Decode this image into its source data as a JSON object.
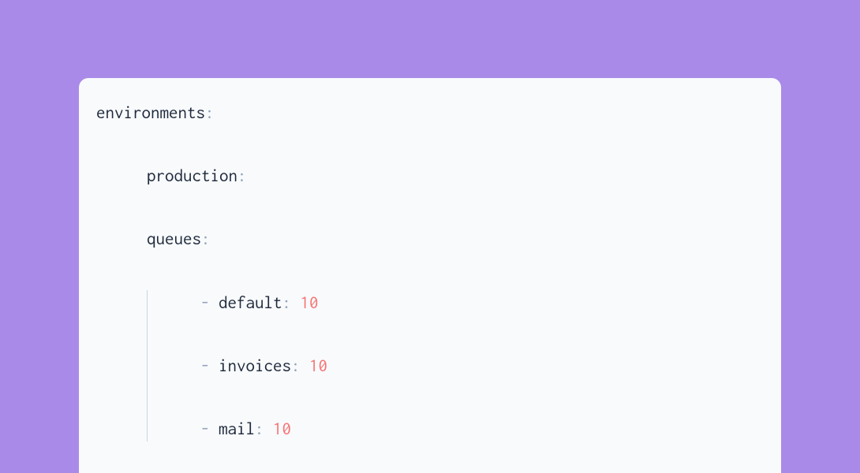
{
  "code": {
    "line1_key": "environments",
    "line2_key": "production",
    "line3_key": "queues",
    "queues": [
      {
        "name": "default",
        "value": "10"
      },
      {
        "name": "invoices",
        "value": "10"
      },
      {
        "name": "mail",
        "value": "10"
      }
    ],
    "colon": ":",
    "dash": "- "
  }
}
